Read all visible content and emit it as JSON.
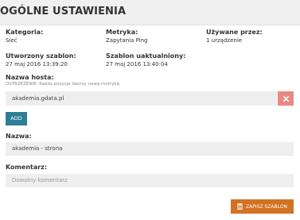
{
  "header": {
    "title": "OGÓLNE USTAWIENIA"
  },
  "info": {
    "category_label": "Kategoria:",
    "category_value": "Sieć",
    "metric_label": "Metryka:",
    "metric_value": "Zapytania Ping",
    "used_by_label": "Używane przez:",
    "used_by_value": "1 urządzenie",
    "created_label": "Utworzony szablon:",
    "created_value": "27 maj 2016 13:39:20",
    "updated_label": "Szablon uaktualniony:",
    "updated_value": "27 maj 2016 13:40:04"
  },
  "host": {
    "label": "Nazwa hosta:",
    "warning": "OSTRZEŻENIE: Każda pozycja tworzy nową metrykę.",
    "entries": [
      "akademia.gdata.pl"
    ],
    "add_label": "ADD"
  },
  "name": {
    "label": "Nazwa:",
    "value": "akademia - strona"
  },
  "comment": {
    "label": "Komentarz:",
    "placeholder": "Dowolny komentarz"
  },
  "actions": {
    "save_label": "ZAPISZ SZABLON"
  },
  "colors": {
    "add_button": "#2c7f94",
    "save_button": "#d27222",
    "remove_button": "#e88a84",
    "field_background": "#eeeeee"
  },
  "icons": {
    "remove": "close-icon",
    "save": "document-icon"
  }
}
